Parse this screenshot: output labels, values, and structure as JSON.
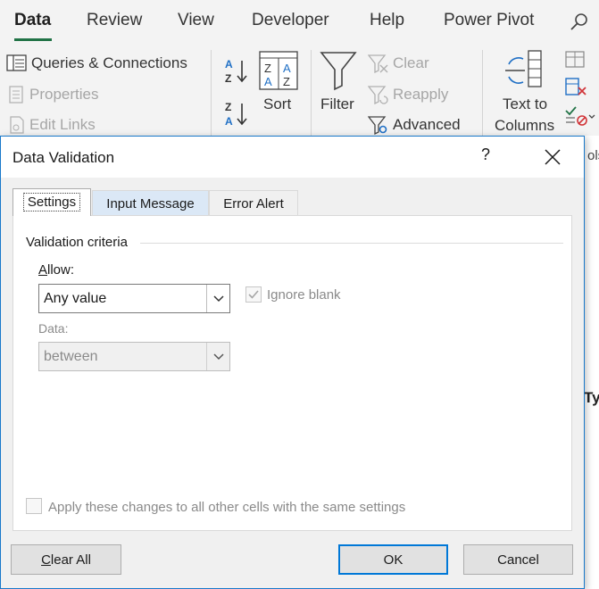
{
  "ribbon": {
    "tabs": [
      "Data",
      "Review",
      "View",
      "Developer",
      "Help",
      "Power Pivot"
    ],
    "active_tab": "Data",
    "accent": "#217346",
    "queries_group": {
      "queries_connections": "Queries & Connections",
      "properties": "Properties",
      "edit_links": "Edit Links"
    },
    "sort_group": {
      "sort": "Sort"
    },
    "filter_group": {
      "filter": "Filter",
      "clear": "Clear",
      "reapply": "Reapply",
      "advanced": "Advanced"
    },
    "data_tools": {
      "text_to_columns_line1": "Text to",
      "text_to_columns_line2": "Columns",
      "tools_fragment": "ols"
    },
    "sheet_fragment": "Ty"
  },
  "dialog": {
    "title": "Data Validation",
    "help": "?",
    "tabs": [
      "Settings",
      "Input Message",
      "Error Alert"
    ],
    "active_tab": "Settings",
    "settings": {
      "group_label": "Validation criteria",
      "allow_label_ul": "A",
      "allow_label_rest": "llow:",
      "allow_value": "Any value",
      "ignore_blank": "Ignore blank",
      "ignore_blank_checked": true,
      "data_label": "Data:",
      "data_value": "between",
      "apply_all": "Apply these changes to all other cells with the same settings",
      "apply_all_checked": false
    },
    "buttons": {
      "clear_all_ul": "C",
      "clear_all_rest": "lear All",
      "ok": "OK",
      "cancel": "Cancel"
    },
    "border_color": "#1979ca"
  }
}
